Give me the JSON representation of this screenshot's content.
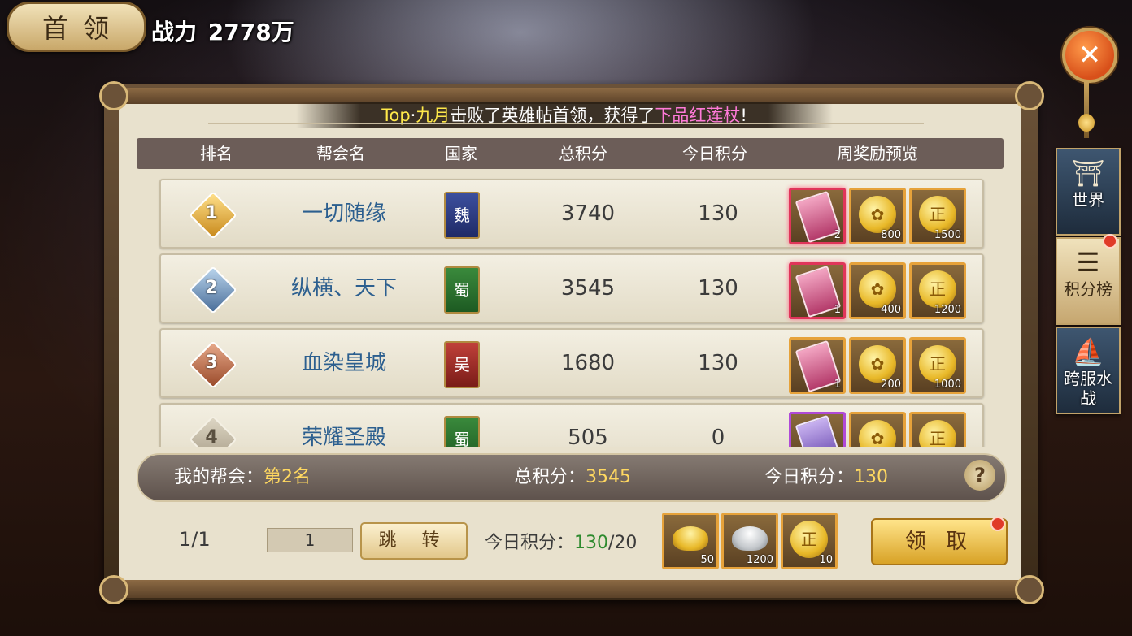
{
  "header": {
    "boss_label": "首领",
    "power_label": "战力",
    "power_value": "2778万"
  },
  "side_menu": [
    {
      "label": "世界",
      "icon": "gate-icon"
    },
    {
      "label": "积分榜",
      "icon": "list-icon"
    },
    {
      "label": "跨服水战",
      "icon": "ship-icon"
    }
  ],
  "ticker": {
    "prefix": "Top",
    "sep": "·",
    "player": "九月",
    "mid": "击败了英雄帖首领，获得了",
    "item": "下品红莲杖",
    "suffix": "!"
  },
  "table": {
    "headers": [
      "排名",
      "帮会名",
      "国家",
      "总积分",
      "今日积分",
      "周奖励预览"
    ],
    "rows": [
      {
        "rank": "1",
        "guild": "一切随缘",
        "country": "魏",
        "total": "3740",
        "today": "130",
        "rewards": [
          {
            "type": "scroll",
            "count": "2"
          },
          {
            "type": "coin",
            "count": "800"
          },
          {
            "type": "coin2",
            "count": "1500"
          }
        ]
      },
      {
        "rank": "2",
        "guild": "纵横、天下",
        "country": "蜀",
        "total": "3545",
        "today": "130",
        "rewards": [
          {
            "type": "scroll",
            "count": "1"
          },
          {
            "type": "coin",
            "count": "400"
          },
          {
            "type": "coin2",
            "count": "1200"
          }
        ]
      },
      {
        "rank": "3",
        "guild": "血染皇城",
        "country": "吴",
        "total": "1680",
        "today": "130",
        "rewards": [
          {
            "type": "scroll",
            "count": "1"
          },
          {
            "type": "coin",
            "count": "200"
          },
          {
            "type": "coin2",
            "count": "1000"
          }
        ]
      },
      {
        "rank": "4",
        "guild": "荣耀圣殿",
        "country": "蜀",
        "total": "505",
        "today": "0",
        "rewards": [
          {
            "type": "scroll",
            "count": ""
          },
          {
            "type": "coin",
            "count": ""
          },
          {
            "type": "coin2",
            "count": ""
          }
        ]
      }
    ]
  },
  "my_guild": {
    "label": "我的帮会：",
    "rank": "第2名",
    "total_label": "总积分：",
    "total": "3545",
    "today_label": "今日积分：",
    "today": "130",
    "help": "?"
  },
  "footer": {
    "page": "1/1",
    "page_input": "1",
    "jump_label": "跳 转",
    "today_label": "今日积分：",
    "today_value": "130",
    "today_max": "/20",
    "rewards": [
      {
        "type": "gold-ingot",
        "count": "50"
      },
      {
        "type": "silver-ingot",
        "count": "1200"
      },
      {
        "type": "coin2",
        "count": "10"
      }
    ],
    "claim_label": "领 取"
  }
}
